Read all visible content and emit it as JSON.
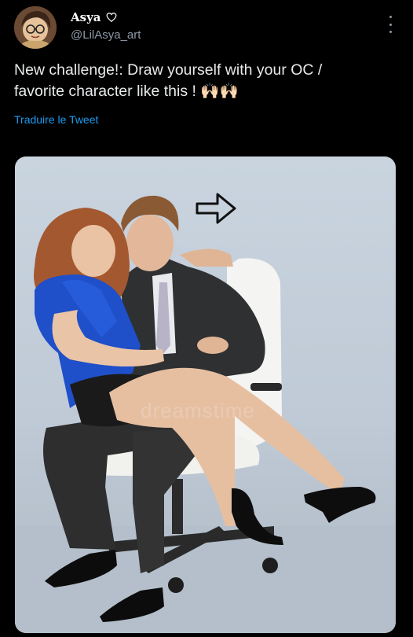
{
  "author": {
    "display_name": "Asya",
    "handle": "@LilAsya_art",
    "avatar_icon": "avatar-illustration",
    "badge_icon": "heart-outline-icon"
  },
  "tweet": {
    "text": "New challenge!: Draw yourself with your OC /\nfavorite character like this ! 🙌🏻🙌🏻",
    "translate_label": "Traduire le Tweet"
  },
  "menu": {
    "icon": "more-vertical-icon"
  },
  "media": {
    "description_icon": "arrow-right-outline-icon",
    "watermark": "dreamstime"
  },
  "colors": {
    "background": "#000000",
    "text": "#e7e9ea",
    "secondary_text": "#8b98a5",
    "link": "#1d9bf0"
  }
}
